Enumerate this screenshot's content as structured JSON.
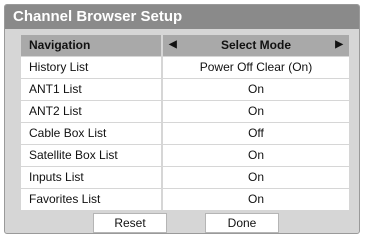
{
  "dialog": {
    "title": "Channel Browser Setup"
  },
  "header": {
    "label": "Navigation",
    "value": "Select Mode",
    "left_arrow_icon": "triangle-left",
    "right_arrow_icon": "triangle-right"
  },
  "rows": [
    {
      "label": "History List",
      "value": "Power Off Clear (On)"
    },
    {
      "label": "ANT1 List",
      "value": "On"
    },
    {
      "label": "ANT2 List",
      "value": "On"
    },
    {
      "label": "Cable Box List",
      "value": "Off"
    },
    {
      "label": "Satellite Box List",
      "value": "On"
    },
    {
      "label": "Inputs List",
      "value": "On"
    },
    {
      "label": "Favorites List",
      "value": "On"
    }
  ],
  "buttons": {
    "reset": "Reset",
    "done": "Done"
  },
  "colors": {
    "title_bar": "#8a8a8a",
    "panel": "#d6d6d6",
    "header_row": "#a9a9a9",
    "cell": "#ffffff"
  }
}
